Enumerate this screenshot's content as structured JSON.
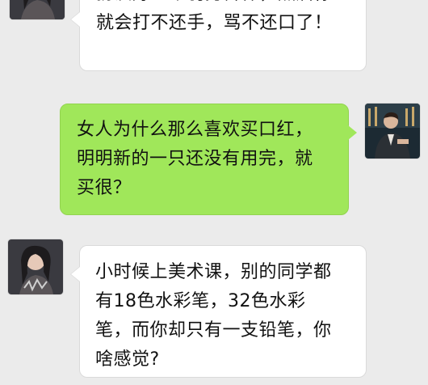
{
  "chat": {
    "messages": [
      {
        "side": "left",
        "avatar_icon": "contact-avatar-icon",
        "lines": [
          "",
          "扮演好一个弱势群体，然后你",
          "就会打不还手，骂不还口了！"
        ]
      },
      {
        "side": "right",
        "avatar_icon": "my-avatar-icon",
        "lines": [
          "女人为什么那么喜欢买口红，",
          "明明新的一只还没有用完，就",
          "买很？"
        ]
      },
      {
        "side": "left",
        "avatar_icon": "contact-avatar-icon",
        "lines": [
          "小时候上美术课，别的同学都",
          "有18色水彩笔，32色水彩",
          "笔，而你却只有一支铅笔，你",
          "啥感觉?"
        ]
      }
    ]
  },
  "colors": {
    "background": "#ebebeb",
    "incoming_bubble": "#ffffff",
    "outgoing_bubble": "#a0e75a"
  }
}
